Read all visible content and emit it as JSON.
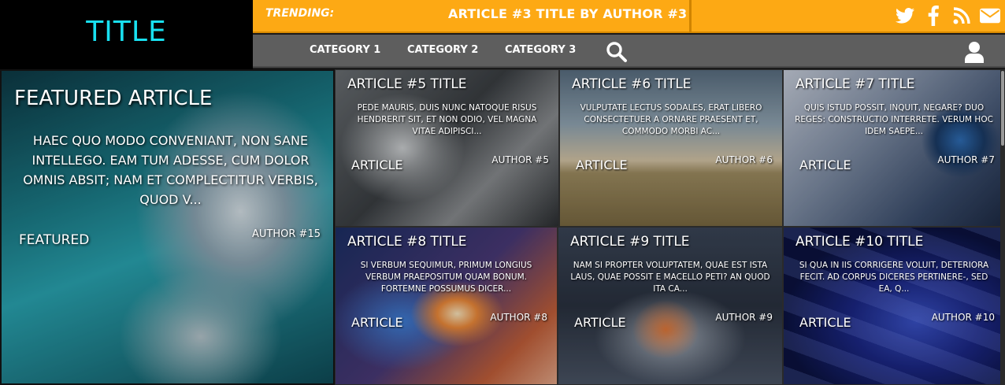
{
  "header": {
    "logo": "TITLE",
    "trending_label": "TRENDING:",
    "trending_article": "ARTICLE #3 TITLE BY AUTHOR #3",
    "social_icons": [
      "twitter-icon",
      "facebook-icon",
      "rss-icon",
      "email-icon"
    ]
  },
  "nav": {
    "items": [
      {
        "label": "CATEGORY 1"
      },
      {
        "label": "CATEGORY 2"
      },
      {
        "label": "CATEGORY 3"
      }
    ],
    "search_icon": "search-icon",
    "user_icon": "user-icon"
  },
  "featured": {
    "title": "FEATURED ARTICLE",
    "excerpt": "HAEC QUO MODO CONVENIANT, NON SANE INTELLEGO. EAM TUM ADESSE, CUM DOLOR OMNIS ABSIT; NAM ET COMPLECTITUR VERBIS, QUOD V...",
    "category": "FEATURED",
    "author": "AUTHOR #15"
  },
  "articles": [
    {
      "title": "ARTICLE #5 TITLE",
      "excerpt": "PEDE MAURIS, DUIS NUNC NATOQUE RISUS HENDRERIT SIT, ET NON ODIO, VEL MAGNA VITAE ADIPISCI...",
      "category": "ARTICLE",
      "author": "AUTHOR #5"
    },
    {
      "title": "ARTICLE #6 TITLE",
      "excerpt": "VULPUTATE LECTUS SODALES, ERAT LIBERO CONSECTETUER A ORNARE PRAESENT ET, COMMODO MORBI AC...",
      "category": "ARTICLE",
      "author": "AUTHOR #6"
    },
    {
      "title": "ARTICLE #7 TITLE",
      "excerpt": "QUIS ISTUD POSSIT, INQUIT, NEGARE? DUO REGES: CONSTRUCTIO INTERRETE. VERUM HOC IDEM SAEPE...",
      "category": "ARTICLE",
      "author": "AUTHOR #7"
    },
    {
      "title": "ARTICLE #8 TITLE",
      "excerpt": "SI VERBUM SEQUIMUR, PRIMUM LONGIUS VERBUM PRAEPOSITUM QUAM BONUM. FORTEMNE POSSUMUS DICER...",
      "category": "ARTICLE",
      "author": "AUTHOR #8"
    },
    {
      "title": "ARTICLE #9 TITLE",
      "excerpt": "NAM SI PROPTER VOLUPTATEM, QUAE EST ISTA LAUS, QUAE POSSIT E MACELLO PETI? AN QUOD ITA CA...",
      "category": "ARTICLE",
      "author": "AUTHOR #9"
    },
    {
      "title": "ARTICLE #10 TITLE",
      "excerpt": "SI QUA IN IIS CORRIGERE VOLUIT, DETERIORA FECIT. AD CORPUS DICERES PERTINERE-, SED EA, Q...",
      "category": "ARTICLE",
      "author": "AUTHOR #10"
    }
  ],
  "colors": {
    "logo_text": "#19e0f0",
    "trending_bar": "#fda914",
    "nav_bar": "#5e5e5e"
  }
}
